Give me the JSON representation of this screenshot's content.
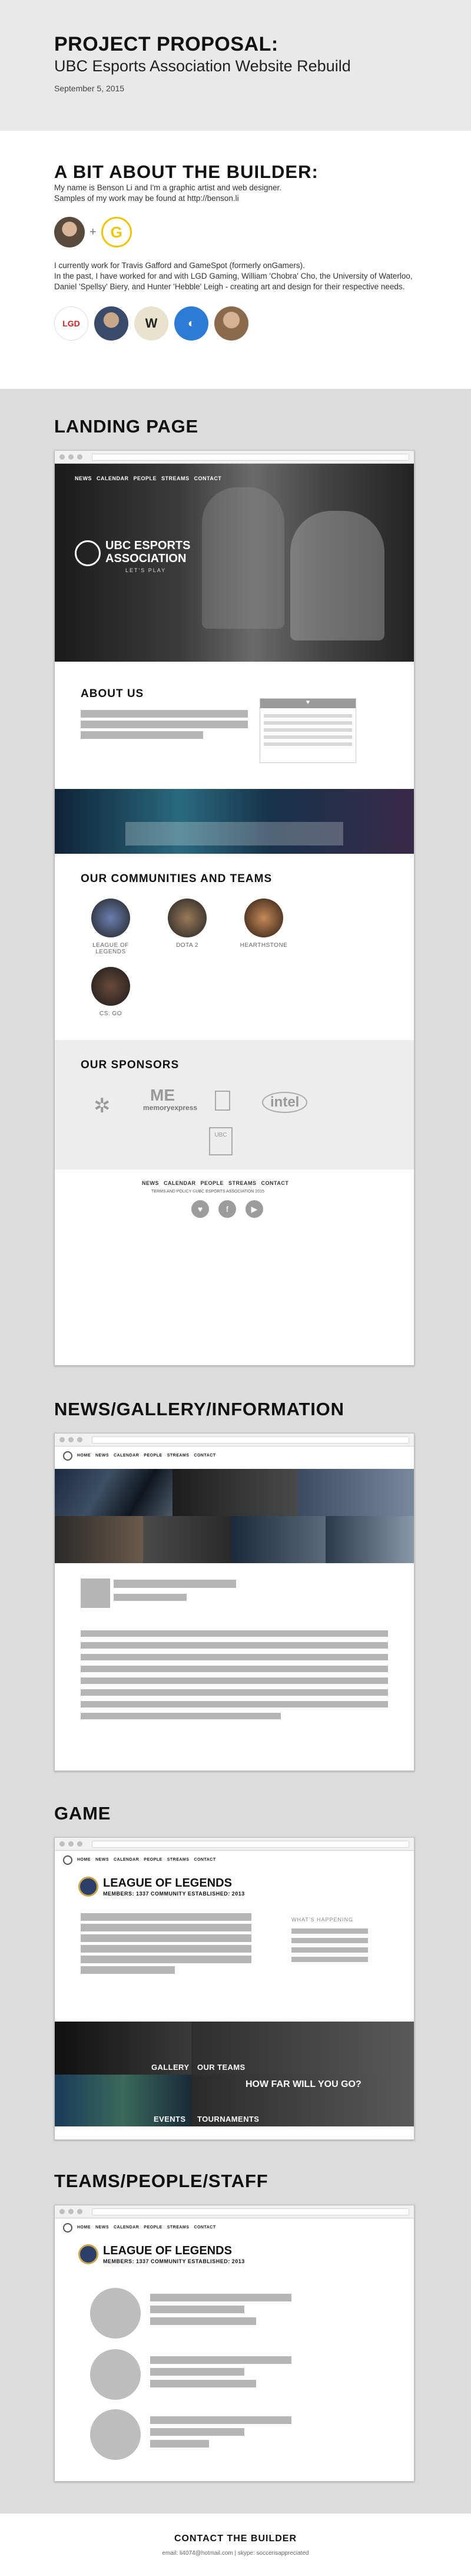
{
  "header": {
    "title": "PROJECT PROPOSAL:",
    "subtitle": "UBC Esports Association Website Rebuild",
    "date": "September 5, 2015"
  },
  "builder": {
    "heading": "A BIT ABOUT THE BUILDER:",
    "intro_1": "My name is Benson Li and I'm a graphic artist and web designer.",
    "intro_2": "Samples of my work may be found at http://benson.li",
    "plus": "+",
    "g_logo": "G",
    "bio_1": "I currently work for Travis Gafford and GameSpot (formerly onGamers).",
    "bio_2": "In the past, I have worked for and with LGD Gaming, William 'Chobra' Cho, the University of Waterloo, Daniel 'Spellsy' Biery, and Hunter 'Hebble' Leigh - creating art and design for their respective needs.",
    "logos": [
      "LGD",
      "",
      "W",
      "",
      ""
    ]
  },
  "landing": {
    "heading": "LANDING PAGE",
    "nav": [
      "NEWS",
      "CALENDAR",
      "PEOPLE",
      "STREAMS",
      "CONTACT"
    ],
    "hero_logo_1": "UBC ESPORTS",
    "hero_logo_2": "ASSOCIATION",
    "hero_tag": "LET'S PLAY",
    "about_title": "ABOUT US",
    "communities_title": "OUR COMMUNITIES AND TEAMS",
    "communities": [
      "LEAGUE OF LEGENDS",
      "DOTA 2",
      "HEARTHSTONE",
      "CS: GO"
    ],
    "sponsors_title": "OUR SPONSORS",
    "sponsors": [
      "memoryexpress",
      "intel",
      "UBC"
    ],
    "footer_nav": [
      "NEWS",
      "CALENDAR",
      "PEOPLE",
      "STREAMS",
      "CONTACT"
    ],
    "footer_terms": "TERMS AND POLICY  ©UBC ESPORTS ASSOCIATION 2015"
  },
  "news": {
    "heading": "NEWS/GALLERY/INFORMATION",
    "nav": [
      "HOME",
      "NEWS",
      "CALENDAR",
      "PEOPLE",
      "STREAMS",
      "CONTACT"
    ]
  },
  "game": {
    "heading": "GAME",
    "nav": [
      "HOME",
      "NEWS",
      "CALENDAR",
      "PEOPLE",
      "STREAMS",
      "CONTACT"
    ],
    "title": "LEAGUE OF LEGENDS",
    "meta": "MEMBERS: 1337  COMMUNITY ESTABLISHED: 2013",
    "sidebar": "WHAT'S HAPPENING",
    "tiles": [
      "GALLERY",
      "OUR TEAMS",
      "EVENTS",
      "TOURNAMENTS"
    ],
    "promo": "HOW FAR WILL YOU GO?"
  },
  "teams": {
    "heading": "TEAMS/PEOPLE/STAFF",
    "nav": [
      "HOME",
      "NEWS",
      "CALENDAR",
      "PEOPLE",
      "STREAMS",
      "CONTACT"
    ],
    "title": "LEAGUE OF LEGENDS",
    "meta": "MEMBERS: 1337  COMMUNITY ESTABLISHED: 2013"
  },
  "footer": {
    "heading": "CONTACT THE BUILDER",
    "info": "email: li4074@hotmail.com   |   skype: soccerisappreciated"
  }
}
